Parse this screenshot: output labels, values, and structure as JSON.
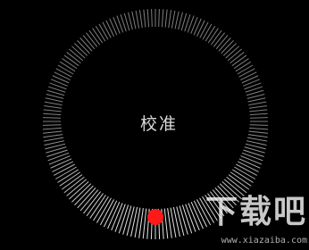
{
  "calibration": {
    "label": "校准",
    "indicator_color": "#ff1a1a",
    "tick_color": "#e6e6e6",
    "background_color": "#000000",
    "ring_icon": "compass-calibration-ring",
    "indicator_icon": "calibration-dot"
  },
  "watermark": {
    "text": "下载吧",
    "url": "www.xiazaiba.com"
  }
}
